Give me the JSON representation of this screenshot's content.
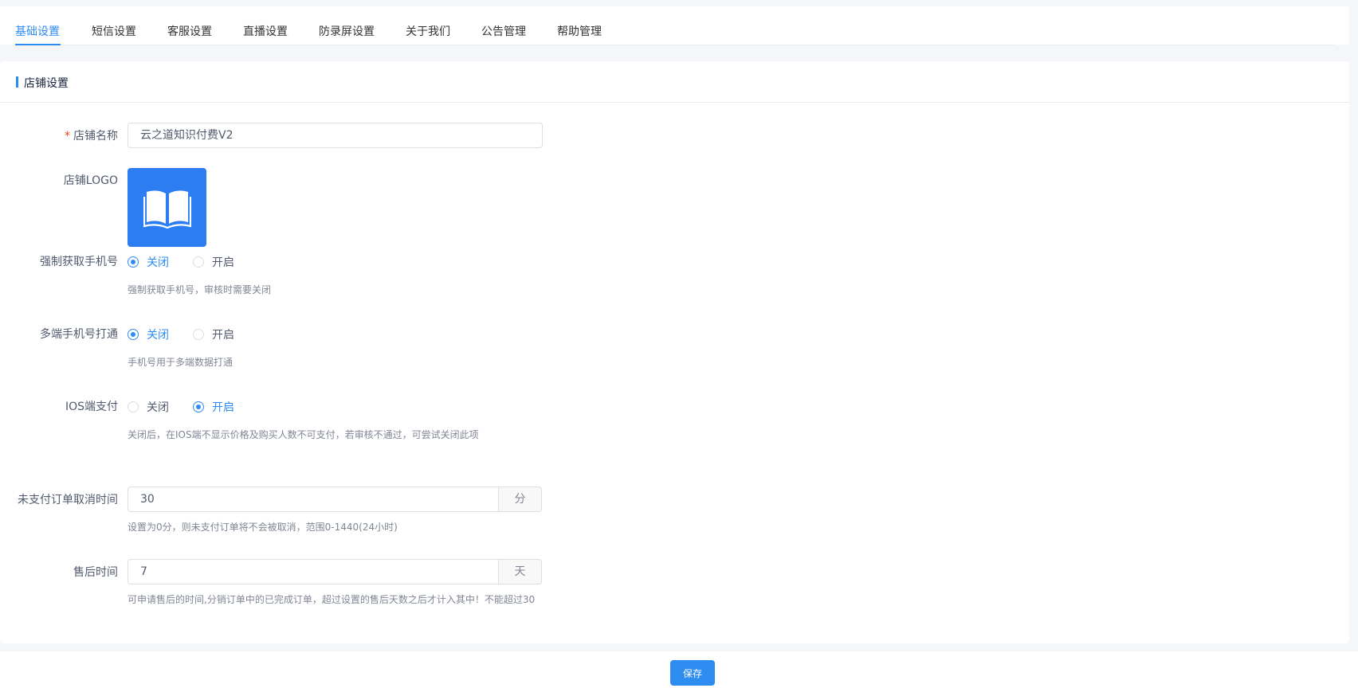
{
  "tabs": [
    {
      "label": "基础设置",
      "active": true
    },
    {
      "label": "短信设置",
      "active": false
    },
    {
      "label": "客服设置",
      "active": false
    },
    {
      "label": "直播设置",
      "active": false
    },
    {
      "label": "防录屏设置",
      "active": false
    },
    {
      "label": "关于我们",
      "active": false
    },
    {
      "label": "公告管理",
      "active": false
    },
    {
      "label": "帮助管理",
      "active": false
    }
  ],
  "section": {
    "title": "店铺设置"
  },
  "form": {
    "store_name": {
      "label": "店铺名称",
      "required_mark": "*",
      "value": "云之道知识付费V2"
    },
    "store_logo": {
      "label": "店铺LOGO",
      "icon": "open-book-icon"
    },
    "force_phone": {
      "label": "强制获取手机号",
      "options": [
        "关闭",
        "开启"
      ],
      "selected": "关闭",
      "hint": "强制获取手机号，审核时需要关闭"
    },
    "multi_phone": {
      "label": "多端手机号打通",
      "options": [
        "关闭",
        "开启"
      ],
      "selected": "关闭",
      "hint": "手机号用于多端数据打通"
    },
    "ios_pay": {
      "label": "IOS端支付",
      "options": [
        "关闭",
        "开启"
      ],
      "selected": "开启",
      "hint": "关闭后，在IOS端不显示价格及购买人数不可支付，若审核不通过，可尝试关闭此项"
    },
    "unpaid_cancel": {
      "label": "未支付订单取消时间",
      "value": "30",
      "unit": "分",
      "hint": "设置为0分，则未支付订单将不会被取消，范围0-1440(24小时)"
    },
    "after_sale": {
      "label": "售后时间",
      "value": "7",
      "unit": "天",
      "hint": "可申请售后的时间,分销订单中的已完成订单，超过设置的售后天数之后才计入其中！不能超过30"
    }
  },
  "footer": {
    "save_label": "保存"
  },
  "colors": {
    "primary": "#2d8cf0",
    "logo_bg": "#2c7cf2",
    "required": "#ed4014"
  }
}
